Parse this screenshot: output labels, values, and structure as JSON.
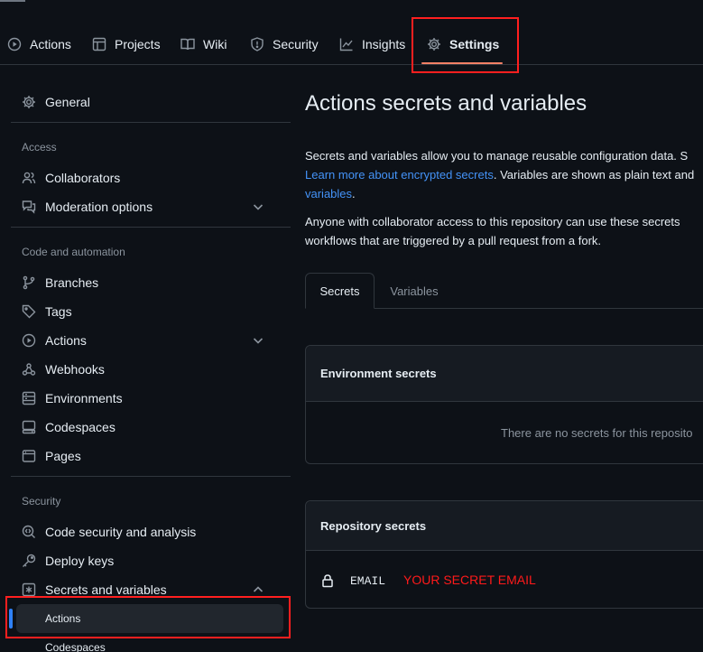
{
  "nav": {
    "tabs": [
      {
        "label": "Actions",
        "icon": "play-icon"
      },
      {
        "label": "Projects",
        "icon": "table-icon"
      },
      {
        "label": "Wiki",
        "icon": "book-icon"
      },
      {
        "label": "Security",
        "icon": "shield-icon"
      },
      {
        "label": "Insights",
        "icon": "graph-icon"
      },
      {
        "label": "Settings",
        "icon": "gear-icon",
        "active": true
      }
    ]
  },
  "sidebar": {
    "general": "General",
    "access_heading": "Access",
    "collaborators": "Collaborators",
    "moderation": "Moderation options",
    "code_heading": "Code and automation",
    "branches": "Branches",
    "tags": "Tags",
    "actions": "Actions",
    "webhooks": "Webhooks",
    "environments": "Environments",
    "codespaces": "Codespaces",
    "pages": "Pages",
    "security_heading": "Security",
    "code_security": "Code security and analysis",
    "deploy_keys": "Deploy keys",
    "secrets_variables": "Secrets and variables",
    "sub_actions": "Actions",
    "sub_codespaces": "Codespaces"
  },
  "main": {
    "title": "Actions secrets and variables",
    "intro_line1": "Secrets and variables allow you to manage reusable configuration data. S",
    "intro_link": "Learn more about encrypted secrets",
    "intro_line2_rest": ". Variables are shown as plain text and",
    "intro_link2": "variables",
    "intro_line3_rest": ".",
    "access_line1": "Anyone with collaborator access to this repository can use these secrets",
    "access_line2": "workflows that are triggered by a pull request from a fork.",
    "tab_secrets": "Secrets",
    "tab_variables": "Variables",
    "env_heading": "Environment secrets",
    "env_empty": "There are no secrets for this reposito",
    "repo_heading": "Repository secrets",
    "secret_name": "EMAIL",
    "secret_annotation": "YOUR SECRET EMAIL"
  },
  "colors": {
    "background": "#0d1117",
    "border": "#30363d",
    "link": "#4493f8",
    "annotation_red": "#ff1f1f",
    "tab_underline": "#f78166"
  }
}
